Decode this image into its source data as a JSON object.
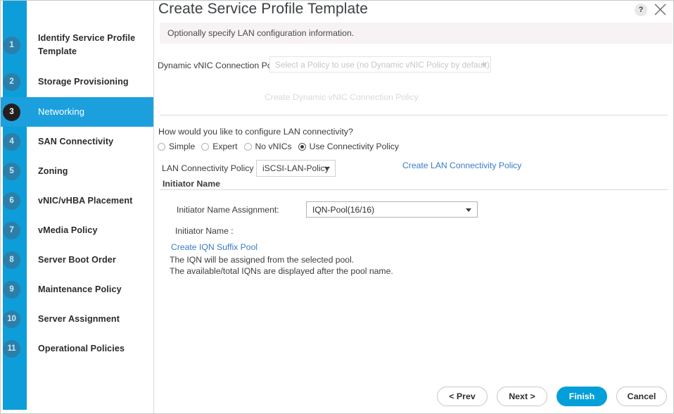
{
  "window": {
    "title": "Create Service Profile Template",
    "help_icon": "question-mark-icon",
    "close_icon": "close-x-icon"
  },
  "banner": {
    "text": "Optionally specify LAN configuration information."
  },
  "sidebar": {
    "steps": [
      {
        "number": "1",
        "label": "Identify Service Profile Template",
        "active": false
      },
      {
        "number": "2",
        "label": "Storage Provisioning",
        "active": false
      },
      {
        "number": "3",
        "label": "Networking",
        "active": true
      },
      {
        "number": "4",
        "label": "SAN Connectivity",
        "active": false
      },
      {
        "number": "5",
        "label": "Zoning",
        "active": false
      },
      {
        "number": "6",
        "label": "vNIC/vHBA Placement",
        "active": false
      },
      {
        "number": "7",
        "label": "vMedia Policy",
        "active": false
      },
      {
        "number": "8",
        "label": "Server Boot Order",
        "active": false
      },
      {
        "number": "9",
        "label": "Maintenance Policy",
        "active": false
      },
      {
        "number": "10",
        "label": "Server Assignment",
        "active": false
      },
      {
        "number": "11",
        "label": "Operational Policies",
        "active": false
      }
    ]
  },
  "form": {
    "dynamic_vnic_label": "Dynamic vNIC Connection Policy:",
    "dynamic_vnic_placeholder": "Select a Policy to use (no Dynamic vNIC Policy by default)",
    "dynamic_vnic_value": "",
    "create_dynamic_vnic_link": "Create Dynamic vNIC Connection Policy",
    "question": "How would you like to configure LAN connectivity?",
    "radios": [
      {
        "label": "Simple",
        "selected": false
      },
      {
        "label": "Expert",
        "selected": false
      },
      {
        "label": "No vNICs",
        "selected": false
      },
      {
        "label": "Use Connectivity Policy",
        "selected": true
      }
    ],
    "lan_policy_label": "LAN Connectivity Policy :",
    "lan_policy_value": "iSCSI-LAN-Policy",
    "create_lan_policy_link": "Create LAN Connectivity Policy",
    "initiator_name_header": "Initiator Name",
    "initiator_assignment_label": "Initiator Name Assignment:",
    "initiator_assignment_value": "IQN-Pool(16/16)",
    "initiator_name_label": "Initiator Name :",
    "create_iqn_suffix_pool_link": "Create IQN Suffix Pool",
    "help_line_1": "The IQN will be assigned from the selected pool.",
    "help_line_2": "The available/total IQNs are displayed after the pool name."
  },
  "footer": {
    "prev": "< Prev",
    "next": "Next >",
    "finish": "Finish",
    "cancel": "Cancel"
  },
  "colors": {
    "rail_blue": "#0d9dd9",
    "active_step_blue": "#1ba0dd",
    "primary_button": "#049fd9",
    "link_blue": "#3a7cc4",
    "banner_bg": "#f7f2f3"
  }
}
